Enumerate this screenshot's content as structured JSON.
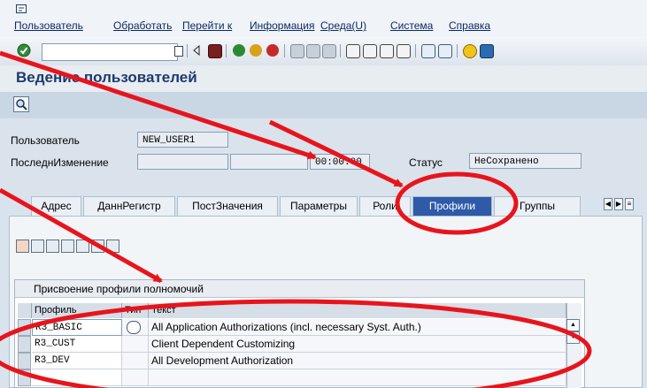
{
  "menu": {
    "items": [
      "Пользователь",
      "Обработать",
      "Перейти к",
      "Информация",
      "Среда(U)",
      "Система",
      "Справка"
    ]
  },
  "toolbar": {
    "command_field_value": "",
    "icons": [
      "enter-icon",
      "save-icon",
      "back-icon",
      "exit-icon",
      "cancel-icon",
      "print-icon",
      "find-icon",
      "find-next-icon",
      "first-page-icon",
      "prev-page-icon",
      "next-page-icon",
      "last-page-icon",
      "create-session-icon",
      "shortcut-icon",
      "help-icon",
      "layout-icon"
    ]
  },
  "title": "Ведение пользователей",
  "header": {
    "user_label": "Пользователь",
    "user_value": "NEW_USER1",
    "last_change_label": "ПоследнИзменение",
    "last_change_time": "00:00:00",
    "status_label": "Статус",
    "status_value": "НеСохранено"
  },
  "tabs": [
    {
      "label": "Адрес",
      "active": false
    },
    {
      "label": "ДаннРегистр",
      "active": false
    },
    {
      "label": "ПостЗначения",
      "active": false
    },
    {
      "label": "Параметры",
      "active": false
    },
    {
      "label": "Роли",
      "active": false
    },
    {
      "label": "Профили",
      "active": true
    },
    {
      "label": "Группы",
      "active": false
    }
  ],
  "profiles_table": {
    "caption": "Присвоение профили полномочий",
    "columns": [
      "Профиль",
      "Тип",
      "Текст"
    ],
    "rows": [
      {
        "profile": "R3_BASIC",
        "type_icon": "composite-profile-icon",
        "text": "All Application Authorizations (incl. necessary Syst. Auth.)"
      },
      {
        "profile": "R3_CUST",
        "type_icon": "",
        "text": "Client Dependent Customizing"
      },
      {
        "profile": "R3_DEV",
        "type_icon": "",
        "text": "All Development Authorization"
      }
    ]
  },
  "annotation_color": "#e8141c"
}
